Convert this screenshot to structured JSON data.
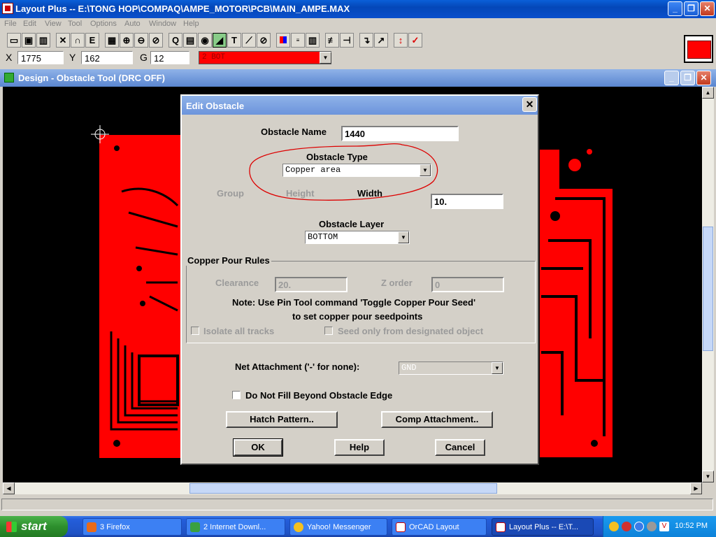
{
  "app": {
    "title": "Layout Plus -- E:\\TONG HOP\\COMPAQ\\AMPE_MOTOR\\PCB\\MAIN_AMPE.MAX",
    "menu": [
      "File",
      "Edit",
      "View",
      "Tool",
      "Options",
      "Auto",
      "Window",
      "Help"
    ]
  },
  "coords": {
    "x_label": "X",
    "x_value": "1775",
    "y_label": "Y",
    "y_value": "162",
    "g_label": "G",
    "g_value": "12",
    "layer": "2  BOT"
  },
  "toolbar_icons": [
    "open-icon",
    "save-icon",
    "library-icon",
    "delete-icon",
    "query-icon",
    "edit-icon",
    "spreadsheet-icon",
    "zoom-in-icon",
    "zoom-out-icon",
    "zoom-all-icon",
    "query-window-icon",
    "component-icon",
    "pin-icon",
    "obstacle-icon",
    "text-icon",
    "connection-icon",
    "error-icon",
    "color-icon",
    "drc-icon",
    "layer-icon",
    "reconnect-icon",
    "route-icon",
    "shove-icon",
    "optimize-icon",
    "online-drc-icon",
    "drc-check-icon"
  ],
  "colors": {
    "layer_color": "#ff0000",
    "board_red": "#ff0000",
    "canvas_bg": "#000000",
    "title_blue": "#0a5fd8"
  },
  "design_window": {
    "title": "Design - Obstacle Tool (DRC OFF)"
  },
  "dialog": {
    "title": "Edit Obstacle",
    "obstacle_name_label": "Obstacle Name",
    "obstacle_name_value": "1440",
    "obstacle_type_label": "Obstacle Type",
    "obstacle_type_value": "Copper area",
    "group_label": "Group",
    "height_label": "Height",
    "width_label": "Width",
    "width_value": "10.",
    "obstacle_layer_label": "Obstacle Layer",
    "obstacle_layer_value": "BOTTOM",
    "copper_pour_title": "Copper Pour Rules",
    "clearance_label": "Clearance",
    "clearance_value": "20.",
    "zorder_label": "Z order",
    "zorder_value": "0",
    "note_line1": "Note: Use Pin Tool command 'Toggle Copper Pour Seed'",
    "note_line2": "to set copper pour seedpoints",
    "isolate_label": "Isolate all tracks",
    "seed_label": "Seed only from designated object",
    "net_label": "Net Attachment ('-' for none):",
    "net_value": "GND",
    "no_fill_label": "Do Not Fill Beyond Obstacle Edge",
    "hatch_button": "Hatch Pattern..",
    "comp_button": "Comp Attachment..",
    "ok_button": "OK",
    "help_button": "Help",
    "cancel_button": "Cancel"
  },
  "taskbar": {
    "start": "start",
    "tasks": [
      {
        "label": "3 Firefox"
      },
      {
        "label": "2 Internet Downl..."
      },
      {
        "label": "Yahoo! Messenger"
      },
      {
        "label": "OrCAD Layout"
      },
      {
        "label": "Layout Plus -- E:\\T..."
      }
    ],
    "clock": "10:52 PM"
  }
}
